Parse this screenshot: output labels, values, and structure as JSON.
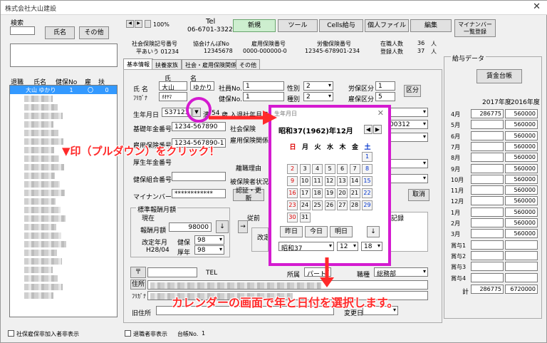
{
  "window": {
    "title": "株式会社大山建設",
    "close": "✕"
  },
  "search": {
    "label": "検索",
    "name_button": "氏名",
    "other_button": "その他"
  },
  "list": {
    "headers": [
      "退職",
      "氏名",
      "健保No",
      "雇",
      "扶"
    ],
    "selected": {
      "name": "大山 ゆかり",
      "no": "1",
      "koyo": "〇",
      "fu": "0"
    }
  },
  "nav": {
    "prev": "◀",
    "next": "▶",
    "zoom": "100%"
  },
  "tel": {
    "label": "Tel",
    "value": "06-6701-3322"
  },
  "toolbar": {
    "new": "新規",
    "tools": "ツール",
    "cells": "Cells給与",
    "file": "個人ファイル",
    "edit": "編集",
    "mynumber": "マイナンバー\n一覧登録"
  },
  "insurance_header": {
    "shaho_label": "社会保険記号番号",
    "shaho_value": "平あいう 01234",
    "kyokai_label": "協会けんぽNo",
    "kyokai_value": "12345678",
    "koyo_label": "雇用保険番号",
    "koyo_value": "0000-000000-0",
    "rodo_label": "労働保険番号",
    "rodo_value": "12345-678901-234",
    "zaishoku_label": "在職人数",
    "zaishoku_value": "36",
    "zaishoku_unit": "人",
    "toroku_label": "登録人数",
    "toroku_value": "37",
    "toroku_unit": "人"
  },
  "tabs": [
    "基本情報",
    "扶養家族",
    "社会・雇用保険関係",
    "その他"
  ],
  "basic": {
    "name_label": "氏 名",
    "sei_header": "氏",
    "mei_header": "名",
    "sei": "大山",
    "mei": "ゆかり",
    "furigana_label": "ﾌﾘｶﾞﾅ",
    "furigana_sei": "ｵｵﾔﾏ",
    "shain_label": "社員No.",
    "shain_value": "1",
    "kenpo_label": "健保No.",
    "kenpo_value": "1",
    "seibetsu_label": "性別",
    "seibetsu_value": "2",
    "shubetsu_label": "種別",
    "shubetsu_value": "2",
    "rodo_kubun_label": "労保区分",
    "rodo_kubun_value": "1",
    "koyo_kubun_label": "雇保区分",
    "koyo_kubun_value": "5",
    "kubun_button": "区分",
    "birth_label": "生年月日",
    "birth_value": "S37123",
    "age_label": "満",
    "age_value": "54",
    "age_unit": "歳",
    "nyusha_label": "入退社年月日",
    "kiso_label": "基礎年金番号",
    "kiso_value": "1234-567890",
    "koyohoken_label": "雇用保険番号",
    "koyohoken_value": "1234-567890-1",
    "kosei_label": "厚生年金番号",
    "kenpo_kumiai_label": "健保組合番号",
    "mynumber_label": "マイナンバー",
    "mynumber_value": "************",
    "shaho_side_label": "社会保険",
    "shaho_side_value": "00312",
    "koyo_side_label": "雇用保険関係",
    "rishoku_label": "離職理由",
    "hihoken_label": "被保険者状況",
    "ninsho_button": "認証・更新",
    "torikeshi_button": "取消",
    "kiroku_label": "記録"
  },
  "standard_pay": {
    "group_label": "標準報酬月額",
    "current_label": "現在",
    "getsugaku_label": "報酬月額",
    "getsugaku_value": "98000",
    "kaitei_label": "改定年月",
    "kaitei_value": "H28/04",
    "kenpo_label": "健保",
    "kenpo_value": "98",
    "kosei_label": "厚年",
    "kosei_value": "98",
    "arrow": "↓",
    "dash": "→",
    "juzen_label": "従前",
    "kaitei_short": "改定"
  },
  "address": {
    "postal_button": "〒",
    "tel_label": "TEL",
    "jusho_button": "住所",
    "furigana_label": "ﾌﾘｶﾞﾅ",
    "kyu_label": "旧住所",
    "shozoku_label": "所属",
    "shozoku_value": "パート",
    "shokushu_label": "職種",
    "shokushu_value": "総務部",
    "henko_label": "変更日"
  },
  "pay_data": {
    "title": "給与データ",
    "ledger_button": "賃金台帳",
    "col1": "2017年度",
    "col2": "2016年度",
    "rows": [
      {
        "m": "4月",
        "a": "286775",
        "b": "560000"
      },
      {
        "m": "5月",
        "a": "",
        "b": "560000"
      },
      {
        "m": "6月",
        "a": "",
        "b": "560000"
      },
      {
        "m": "7月",
        "a": "",
        "b": "560000"
      },
      {
        "m": "8月",
        "a": "",
        "b": "560000"
      },
      {
        "m": "9月",
        "a": "",
        "b": "560000"
      },
      {
        "m": "10月",
        "a": "",
        "b": "560000"
      },
      {
        "m": "11月",
        "a": "",
        "b": "560000"
      },
      {
        "m": "12月",
        "a": "",
        "b": "560000"
      },
      {
        "m": "1月",
        "a": "",
        "b": "560000"
      },
      {
        "m": "2月",
        "a": "",
        "b": "560000"
      },
      {
        "m": "3月",
        "a": "",
        "b": "560000"
      },
      {
        "m": "賞与1",
        "a": "",
        "b": ""
      },
      {
        "m": "賞与2",
        "a": "",
        "b": ""
      },
      {
        "m": "賞与3",
        "a": "",
        "b": ""
      },
      {
        "m": "賞与4",
        "a": "",
        "b": ""
      }
    ],
    "total_label": "計",
    "total_a": "286775",
    "total_b": "6720000"
  },
  "calendar": {
    "title": "生年月日",
    "close": "✕",
    "year_month": "昭和37(1962)年12月",
    "prev": "◀",
    "next": "▶",
    "weekdays": [
      "日",
      "月",
      "火",
      "水",
      "木",
      "金",
      "土"
    ],
    "weeks": [
      [
        "",
        "",
        "",
        "",
        "",
        "",
        "1"
      ],
      [
        "2",
        "3",
        "4",
        "5",
        "6",
        "7",
        "8"
      ],
      [
        "9",
        "10",
        "11",
        "12",
        "13",
        "14",
        "15"
      ],
      [
        "16",
        "17",
        "18",
        "19",
        "20",
        "21",
        "22"
      ],
      [
        "23",
        "24",
        "25",
        "26",
        "27",
        "28",
        "29"
      ],
      [
        "30",
        "31",
        "",
        "",
        "",
        "",
        ""
      ]
    ],
    "yesterday": "昨日",
    "today": "今日",
    "tomorrow": "明日",
    "down": "↓",
    "era_value": "昭和37",
    "month_value": "12",
    "day_value": "18"
  },
  "footer": {
    "check1": "社保雇保非加入者非表示",
    "check2": "退職者非表示",
    "daicho_label": "台帳No.",
    "daicho_value": "1"
  },
  "annotations": {
    "click_text": "▼印（プルダウン）をクリック！",
    "select_text": "カレンダーの画面で年と日付を選択します。"
  },
  "colors": {
    "annotation": "#ff2a2a",
    "highlight": "#d41bd0",
    "selection": "#3399ff"
  }
}
